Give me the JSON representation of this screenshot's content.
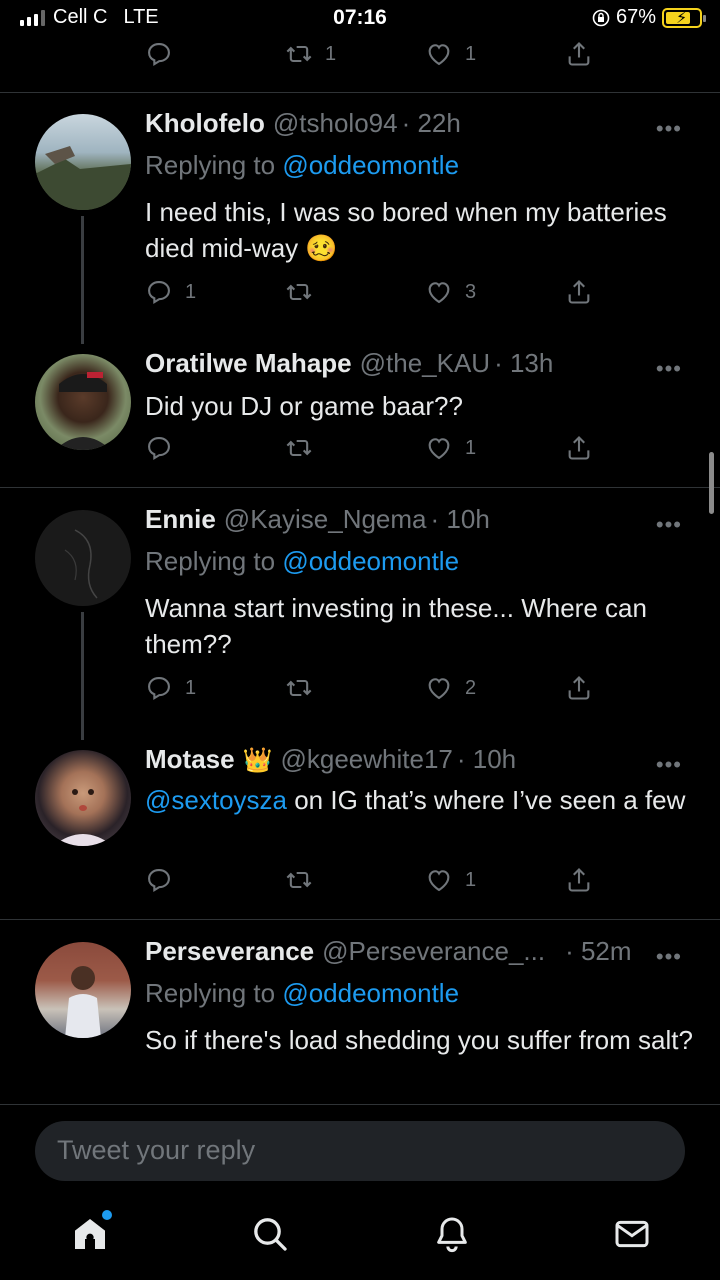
{
  "status": {
    "carrier": "Cell C",
    "network": "LTE",
    "time": "07:16",
    "battery": "67%"
  },
  "top_actions": {
    "retweets": "1",
    "likes": "1"
  },
  "tweets": [
    {
      "name": "Kholofelo",
      "handle": "@tsholo94",
      "time": "· 22h",
      "replying_prefix": "Replying to",
      "replying_to": "@oddeomontle",
      "text": "I need this, I was so bored when my batteries died mid-way 🥴",
      "replies": "1",
      "retweets": "",
      "likes": "3"
    },
    {
      "name": "Oratilwe Mahape",
      "handle": "@the_KAU",
      "time": "· 13h",
      "text": "Did you DJ or game baar??",
      "replies": "",
      "retweets": "",
      "likes": "1"
    },
    {
      "name": "Ennie",
      "handle": "@Kayise_Ngema",
      "time": "· 10h",
      "replying_prefix": "Replying to",
      "replying_to": "@oddeomontle",
      "text": "Wanna start investing in these... Where can them??",
      "replies": "1",
      "retweets": "",
      "likes": "2"
    },
    {
      "name": "Motase",
      "badge": "👑",
      "handle": "@kgeewhite17",
      "time": "· 10h",
      "text_mention": "@sextoysza",
      "text": " on IG that’s where I’ve seen a few",
      "replies": "",
      "retweets": "",
      "likes": "1"
    },
    {
      "name": "Perseverance",
      "handle": "@Perseverance_...",
      "time": "· 52m",
      "replying_prefix": "Replying to",
      "replying_to": "@oddeomontle",
      "text": "So if there's load shedding you suffer from salt?"
    }
  ],
  "reply_box": {
    "placeholder": "Tweet your reply"
  },
  "more_label": "•••",
  "nav": [
    "home-icon",
    "search-icon",
    "notifications-icon",
    "messages-icon"
  ],
  "colors": {
    "accent": "#1d9bf0",
    "muted": "#71767b",
    "background": "#000000"
  }
}
